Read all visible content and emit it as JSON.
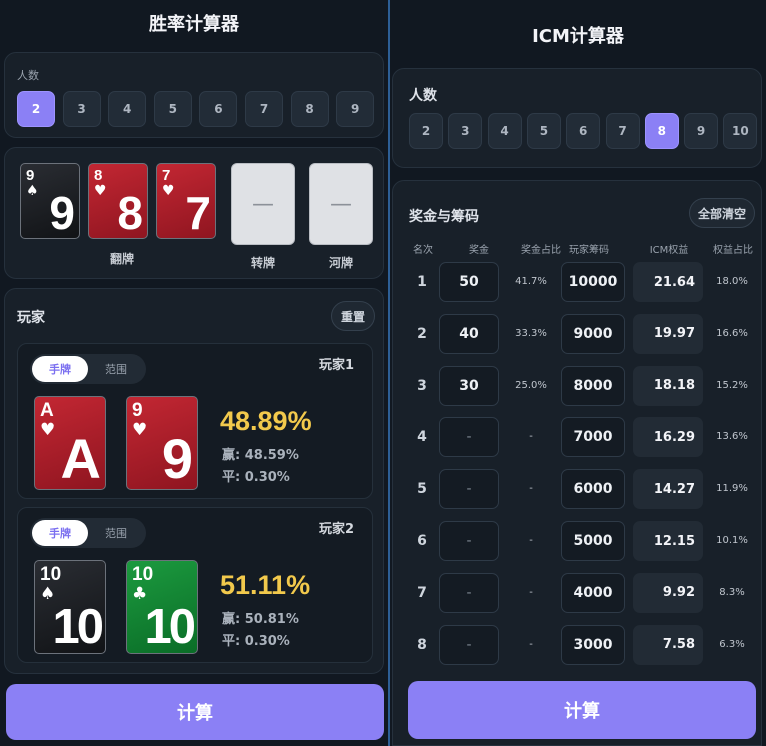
{
  "left": {
    "title": "胜率计算器",
    "players_label": "人数",
    "counts": [
      "2",
      "3",
      "4",
      "5",
      "6",
      "7",
      "8",
      "9"
    ],
    "board": {
      "flop": [
        {
          "rank": "9",
          "suit": "♠",
          "color": "black"
        },
        {
          "rank": "8",
          "suit": "♥",
          "color": "red"
        },
        {
          "rank": "7",
          "suit": "♥",
          "color": "red"
        }
      ],
      "flop_label": "翻牌",
      "turn_label": "转牌",
      "river_label": "河牌",
      "empty_placeholder": "—"
    },
    "players_section": "玩家",
    "reset": "重置",
    "mode_hand": "手牌",
    "mode_range": "范围",
    "players": [
      {
        "name": "玩家1",
        "cards": [
          {
            "rank": "A",
            "suit": "♥",
            "color": "red"
          },
          {
            "rank": "9",
            "suit": "♥",
            "color": "red"
          }
        ],
        "equity": "48.89%",
        "win": "赢: 48.59%",
        "tie": "平: 0.30%"
      },
      {
        "name": "玩家2",
        "cards": [
          {
            "rank": "10",
            "suit": "♠",
            "color": "black"
          },
          {
            "rank": "10",
            "suit": "♣",
            "color": "green"
          }
        ],
        "equity": "51.11%",
        "win": "赢: 50.81%",
        "tie": "平: 0.30%"
      }
    ],
    "calculate": "计算"
  },
  "right": {
    "title": "ICM计算器",
    "players_label": "人数",
    "counts": [
      "2",
      "3",
      "4",
      "5",
      "6",
      "7",
      "8",
      "9",
      "10"
    ],
    "section": "奖金与筹码",
    "clear_all": "全部清空",
    "headers": [
      "名次",
      "奖金",
      "奖金占比",
      "玩家筹码",
      "ICM权益",
      "权益占比"
    ],
    "rows": [
      {
        "rank": "1",
        "prize": "50",
        "prize_pct": "41.7%",
        "chips": "10000",
        "icm": "21.64",
        "icm_pct": "18.0%"
      },
      {
        "rank": "2",
        "prize": "40",
        "prize_pct": "33.3%",
        "chips": "9000",
        "icm": "19.97",
        "icm_pct": "16.6%"
      },
      {
        "rank": "3",
        "prize": "30",
        "prize_pct": "25.0%",
        "chips": "8000",
        "icm": "18.18",
        "icm_pct": "15.2%"
      },
      {
        "rank": "4",
        "prize": "-",
        "prize_pct": "-",
        "chips": "7000",
        "icm": "16.29",
        "icm_pct": "13.6%"
      },
      {
        "rank": "5",
        "prize": "-",
        "prize_pct": "-",
        "chips": "6000",
        "icm": "14.27",
        "icm_pct": "11.9%"
      },
      {
        "rank": "6",
        "prize": "-",
        "prize_pct": "-",
        "chips": "5000",
        "icm": "12.15",
        "icm_pct": "10.1%"
      },
      {
        "rank": "7",
        "prize": "-",
        "prize_pct": "-",
        "chips": "4000",
        "icm": "9.92",
        "icm_pct": "8.3%"
      },
      {
        "rank": "8",
        "prize": "-",
        "prize_pct": "-",
        "chips": "3000",
        "icm": "7.58",
        "icm_pct": "6.3%"
      }
    ],
    "calculate": "计算"
  },
  "colors": {
    "accent": "#8b80f5",
    "equity": "#f2c94c",
    "divider": "#2d5f96"
  }
}
